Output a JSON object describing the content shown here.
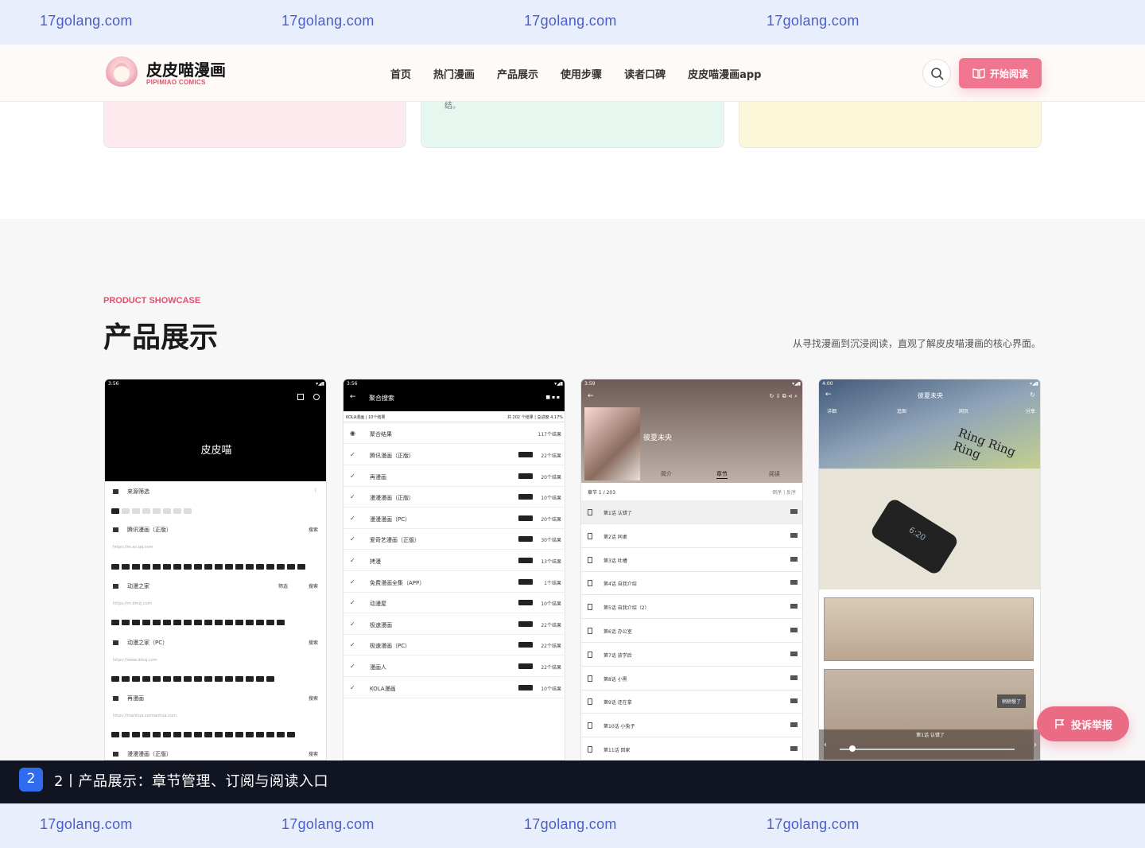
{
  "watermarks": {
    "text": "17golang.com"
  },
  "nav": {
    "brand": "皮皮喵漫画",
    "brand_sub": "PIPIMIAO COMICS",
    "links": [
      "首页",
      "热门漫画",
      "产品展示",
      "使用步骤",
      "读者口碑",
      "皮皮喵漫画app"
    ],
    "read_button": "开始阅读"
  },
  "cards": {
    "card2_tail": "结。"
  },
  "showcase": {
    "kicker": "PRODUCT SHOWCASE",
    "title": "产品展示",
    "desc": "从寻找漫画到沉浸阅读，直观了解皮皮喵漫画的核心界面。"
  },
  "shot1": {
    "time": "3:56",
    "header_title": "皮皮喵",
    "filter": "来源筛选",
    "rows": [
      {
        "name": "腾讯漫画（正版）",
        "action": "搜索",
        "url": "https://m.ac.qq.com"
      },
      {
        "name": "动漫之家",
        "action": "搜索",
        "filter": "筛选",
        "url": "https://m.dmzj.com"
      },
      {
        "name": "动漫之家（PC）",
        "action": "搜索",
        "url": "https://www.dmzj.com"
      },
      {
        "name": "再漫画",
        "action": "搜索",
        "url": "https://manhua.zaimanhua.com"
      },
      {
        "name": "漫漫漫画（正版）",
        "action": "搜索"
      }
    ]
  },
  "shot2": {
    "time": "3:56",
    "title": "聚合搜索",
    "summary_left": "KOLA漫画 | 10个结果",
    "summary_right": "共 202 个结果 | 总进度 4.17%",
    "head_row": {
      "name": "聚合结果",
      "count": "117个结果"
    },
    "rows": [
      {
        "name": "腾讯漫画（正版）",
        "count": "22个结果"
      },
      {
        "name": "再漫画",
        "count": "20个结果"
      },
      {
        "name": "漫漫漫画（正版）",
        "count": "10个结果"
      },
      {
        "name": "漫漫漫画（PC）",
        "count": "20个结果"
      },
      {
        "name": "爱奇艺漫画（正版）",
        "count": "30个结果"
      },
      {
        "name": "拷漫",
        "count": "13个结果"
      },
      {
        "name": "免费漫画全集（APP）",
        "count": "1个结果"
      },
      {
        "name": "动漫屋",
        "count": "10个结果"
      },
      {
        "name": "极速漫画",
        "count": "22个结果"
      },
      {
        "name": "极速漫画（PC）",
        "count": "22个结果"
      },
      {
        "name": "漫画人",
        "count": "22个结果"
      },
      {
        "name": "KOLA漫画",
        "count": "10个结果"
      }
    ]
  },
  "shot3": {
    "time": "3:59",
    "comic_title": "彼夏未央",
    "tabs": [
      "简介",
      "章节",
      "阅读"
    ],
    "chapter_count": "章节 1 / 203",
    "sort": "倒序 | 反序",
    "chapters": [
      "第1话 认错了",
      "第2话 同桌",
      "第3话 吐槽",
      "第4话 自我介绍",
      "第5话 自我介绍（2）",
      "第6话 办公室",
      "第7话 放学后",
      "第8话 小黑",
      "第9话 还在拿",
      "第10话 小兔子",
      "第11话 回家"
    ]
  },
  "shot4": {
    "time": "4:00",
    "title": "彼夏未央",
    "opts": [
      "详细",
      "追图",
      "网页",
      "分享"
    ],
    "sfx": "Ring Ring Ring",
    "phone_time": "6:20",
    "badge": "稍稍慢了",
    "page_label": "第1话 认错了"
  },
  "report": {
    "label": "投诉举报"
  },
  "caption": {
    "num": "2",
    "text": "2丨产品展示：章节管理、订阅与阅读入口"
  }
}
